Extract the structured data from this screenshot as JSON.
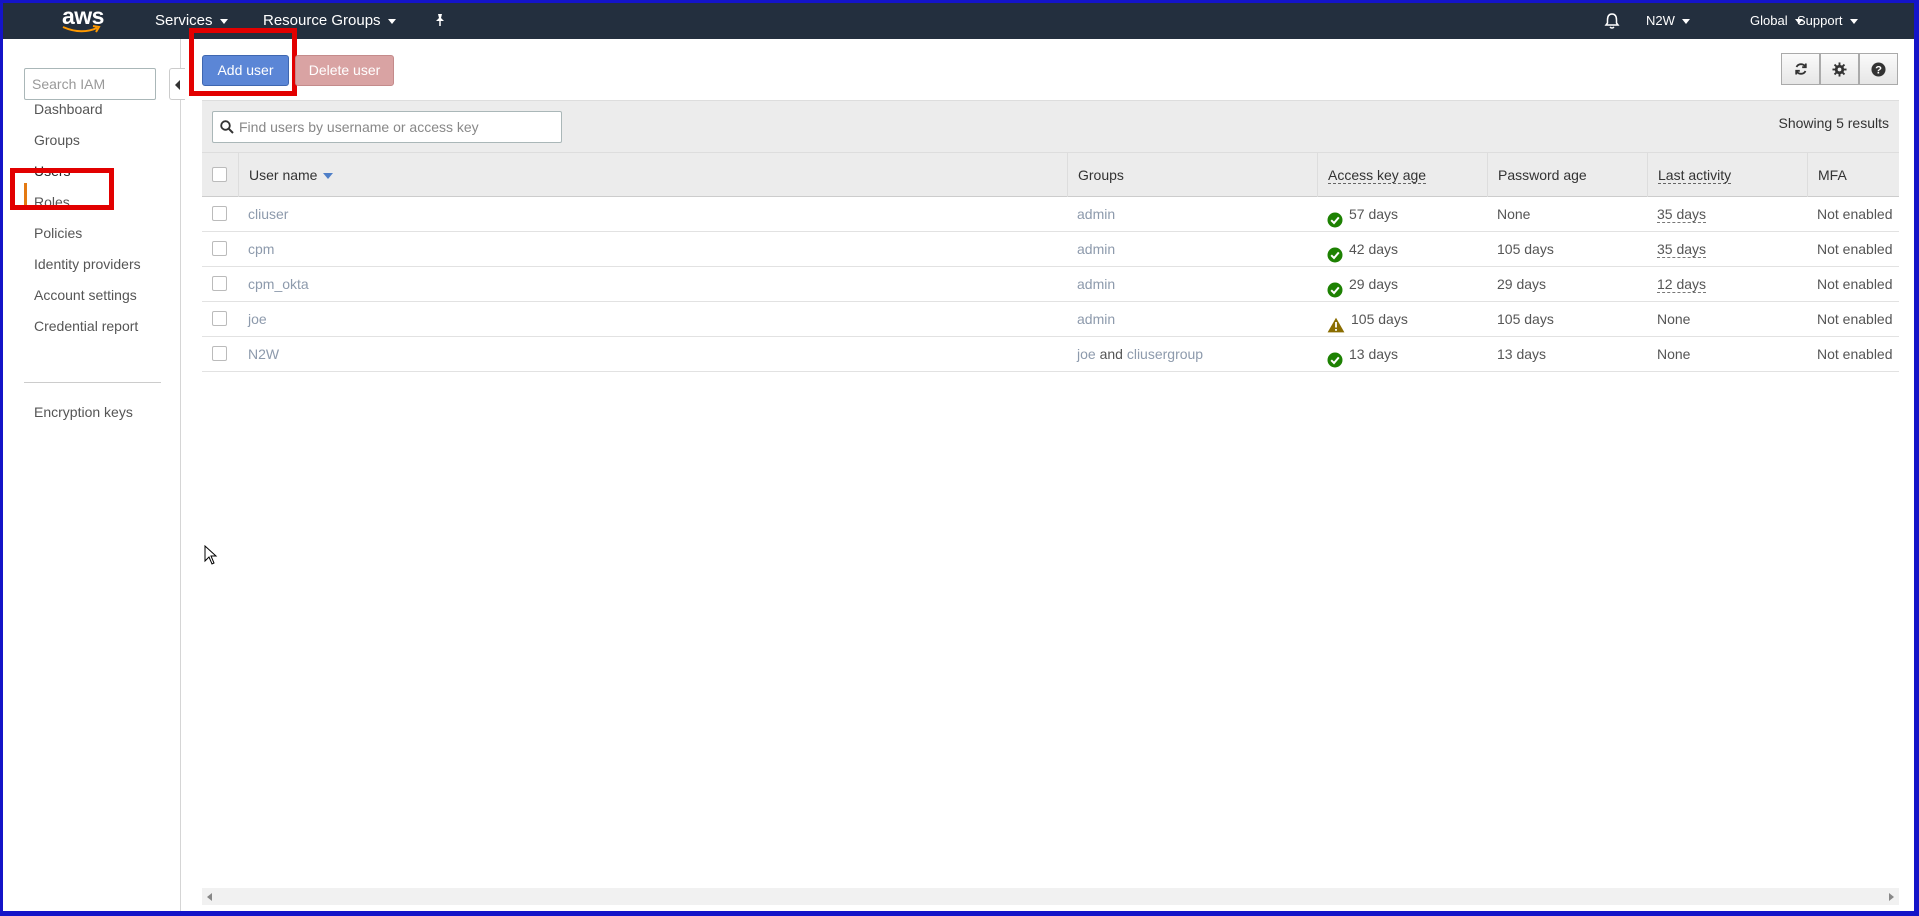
{
  "topnav": {
    "logo": "aws",
    "services": "Services",
    "resource_groups": "Resource Groups",
    "pin_icon": "pin-icon",
    "bell_icon": "bell-icon",
    "account": "N2W",
    "region": "Global",
    "support": "Support"
  },
  "sidebar": {
    "search_placeholder": "Search IAM",
    "items": [
      {
        "label": "Dashboard"
      },
      {
        "label": "Groups"
      },
      {
        "label": "Users",
        "active": true
      },
      {
        "label": "Roles"
      },
      {
        "label": "Policies"
      },
      {
        "label": "Identity providers"
      },
      {
        "label": "Account settings"
      },
      {
        "label": "Credential report"
      }
    ],
    "extra_item": "Encryption keys"
  },
  "toolbar": {
    "add_user": "Add user",
    "delete_user": "Delete user",
    "refresh_icon": "refresh-icon",
    "settings_icon": "gear-icon",
    "help_icon": "help-icon"
  },
  "filter": {
    "placeholder": "Find users by username or access key",
    "results": "Showing 5 results"
  },
  "table": {
    "columns": [
      "User name",
      "Groups",
      "Access key age",
      "Password age",
      "Last activity",
      "MFA"
    ],
    "rows": [
      {
        "user": "cliuser",
        "group1": "admin",
        "group_sep": "",
        "group2": "",
        "key_status": "ok",
        "key_age": "57 days",
        "password_age": "None",
        "last_activity": "35 days",
        "mfa": "Not enabled"
      },
      {
        "user": "cpm",
        "group1": "admin",
        "group_sep": "",
        "group2": "",
        "key_status": "ok",
        "key_age": "42 days",
        "password_age": "105 days",
        "last_activity": "35 days",
        "mfa": "Not enabled"
      },
      {
        "user": "cpm_okta",
        "group1": "admin",
        "group_sep": "",
        "group2": "",
        "key_status": "ok",
        "key_age": "29 days",
        "password_age": "29 days",
        "last_activity": "12 days",
        "mfa": "Not enabled"
      },
      {
        "user": "joe",
        "group1": "admin",
        "group_sep": "",
        "group2": "",
        "key_status": "warning",
        "key_age": "105 days",
        "password_age": "105 days",
        "last_activity": "None",
        "mfa": "Not enabled"
      },
      {
        "user": "N2W",
        "group1": "joe",
        "group_sep": "and",
        "group2": "cliusergroup",
        "key_status": "ok",
        "key_age": "13 days",
        "password_age": "13 days",
        "last_activity": "None",
        "mfa": "Not enabled"
      }
    ]
  },
  "colors": {
    "nav_bg": "#232f3e",
    "primary": "#5b86d6",
    "danger": "#d9a3a3",
    "ok": "#1d8102",
    "warning": "#8a6d00",
    "highlight": "#e20000"
  }
}
